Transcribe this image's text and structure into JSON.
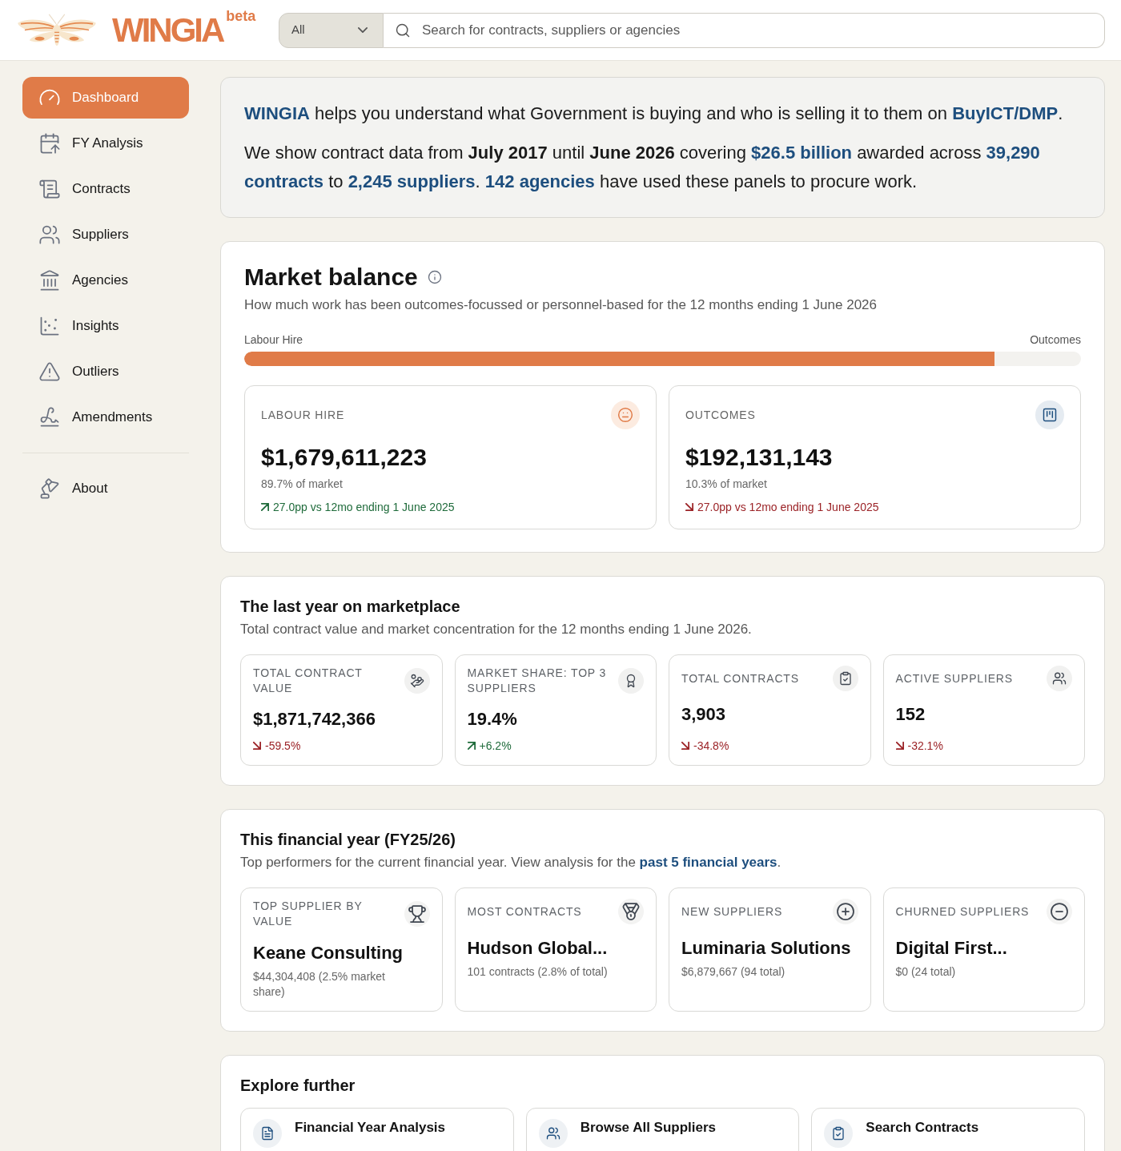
{
  "header": {
    "logo": {
      "wordmark": "WINGIA",
      "badge": "beta"
    },
    "search": {
      "scope": "All",
      "placeholder": "Search for contracts, suppliers or agencies"
    }
  },
  "sidebar": {
    "items": [
      {
        "label": "Dashboard",
        "selected": true
      },
      {
        "label": "FY Analysis",
        "selected": false
      },
      {
        "label": "Contracts",
        "selected": false
      },
      {
        "label": "Suppliers",
        "selected": false
      },
      {
        "label": "Agencies",
        "selected": false
      },
      {
        "label": "Insights",
        "selected": false
      },
      {
        "label": "Outliers",
        "selected": false
      },
      {
        "label": "Amendments",
        "selected": false
      }
    ],
    "footer_items": [
      {
        "label": "About",
        "selected": false
      }
    ]
  },
  "intro": {
    "paragraphs": [
      [
        {
          "kind": "highlight",
          "text": "WINGIA"
        },
        {
          "kind": "plain",
          "text": " helps you understand what Government is buying and who is selling it to them on "
        },
        {
          "kind": "link",
          "text": "BuyICT/DMP"
        },
        {
          "kind": "plain",
          "text": "."
        }
      ],
      [
        {
          "kind": "plain",
          "text": "We show contract data from "
        },
        {
          "kind": "strong",
          "text": "July 2017"
        },
        {
          "kind": "plain",
          "text": " until "
        },
        {
          "kind": "strong",
          "text": "June 2026"
        },
        {
          "kind": "plain",
          "text": " covering "
        },
        {
          "kind": "highlight",
          "text": "$26.5 billion"
        },
        {
          "kind": "plain",
          "text": " awarded across "
        },
        {
          "kind": "highlight",
          "text": "39,290 contracts"
        },
        {
          "kind": "plain",
          "text": " to "
        },
        {
          "kind": "highlight",
          "text": "2,245 suppliers"
        },
        {
          "kind": "plain",
          "text": ". "
        },
        {
          "kind": "highlight",
          "text": "142 agencies"
        },
        {
          "kind": "plain",
          "text": " have used these panels to procure work."
        }
      ]
    ]
  },
  "market_balance": {
    "title": "Market balance",
    "subtitle": "How much work has been outcomes-focussed or personnel-based for the 12 months ending 1 June 2026",
    "bar": {
      "left_label": "Labour Hire",
      "right_label": "Outcomes",
      "level": 0.897
    },
    "cards": [
      {
        "label": "LABOUR HIRE",
        "value": "$1,679,611,223",
        "share": "89.7% of market",
        "change": "27.0pp vs 12mo ending 1 June 2025",
        "rising": true
      },
      {
        "label": "OUTCOMES",
        "value": "$192,131,143",
        "share": "10.3% of market",
        "change": "27.0pp vs 12mo ending 1 June 2025",
        "rising": false
      }
    ]
  },
  "last_year": {
    "title": "The last year on marketplace",
    "subtitle": "Total contract value and market concentration for the 12 months ending 1 June 2026.",
    "stats": [
      {
        "label": "TOTAL CONTRACT VALUE",
        "value": "$1,871,742,366",
        "change": "-59.5%",
        "rising": false
      },
      {
        "label": "MARKET SHARE: TOP 3 SUPPLIERS",
        "value": "19.4%",
        "change": "+6.2%",
        "rising": true
      },
      {
        "label": "TOTAL CONTRACTS",
        "value": "3,903",
        "change": "-34.8%",
        "rising": false
      },
      {
        "label": "ACTIVE SUPPLIERS",
        "value": "152",
        "change": "-32.1%",
        "rising": false
      }
    ]
  },
  "financial_year": {
    "title": "This financial year (FY25/26)",
    "subtitle": [
      {
        "kind": "plain",
        "text": "Top performers for the current financial year. View analysis for the "
      },
      {
        "kind": "link",
        "text": "past 5 financial years"
      },
      {
        "kind": "plain",
        "text": "."
      }
    ],
    "cards": [
      {
        "label": "TOP SUPPLIER BY VALUE",
        "name": "Keane Consulting",
        "detail": "$44,304,408 (2.5% market share)"
      },
      {
        "label": "MOST CONTRACTS",
        "name": "Hudson Global...",
        "detail": "101 contracts (2.8% of total)"
      },
      {
        "label": "NEW SUPPLIERS",
        "name": "Luminaria Solutions",
        "detail": "$6,879,667 (94 total)"
      },
      {
        "label": "CHURNED SUPPLIERS",
        "name": "Digital First...",
        "detail": "$0 (24 total)"
      }
    ]
  },
  "explore": {
    "title": "Explore further",
    "links": [
      {
        "label": "Financial Year Analysis"
      },
      {
        "label": "Browse All Suppliers"
      },
      {
        "label": "Search Contracts"
      }
    ]
  }
}
